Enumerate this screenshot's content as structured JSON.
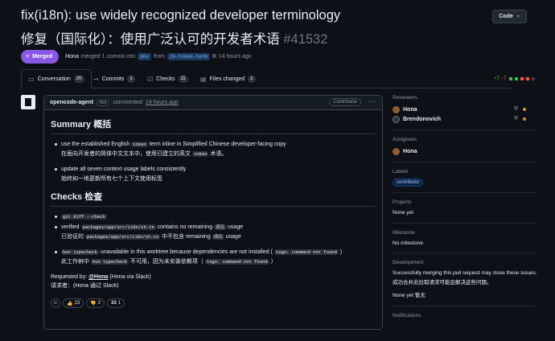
{
  "header": {
    "title": "fix(i18n): use widely recognized developer terminology",
    "subtitle": "修复（国际化）：使用广泛认可的开发者术语",
    "number": "#41532",
    "code_button": "Code"
  },
  "meta": {
    "status": "Merged",
    "author": "Hona",
    "action": "merged 1 commit into",
    "base_branch": "dev",
    "from_word": "from",
    "head_branch": "zh-token-term",
    "time": "14 hours ago"
  },
  "tabs": [
    {
      "label": "Conversation",
      "count": "20"
    },
    {
      "label": "Commits",
      "count": "1"
    },
    {
      "label": "Checks",
      "count": "11"
    },
    {
      "label": "Files changed",
      "count": "1"
    }
  ],
  "diffstat": {
    "add": "+7",
    "del": "−7"
  },
  "comment": {
    "author": "opencode-agent",
    "bot": "Bot",
    "action": "commented",
    "time": "14 hours ago",
    "role": "Contributor",
    "summary_heading": "Summary  概括",
    "summary_items": [
      {
        "pre": "use the established English",
        "code": "token",
        "post": "term inline in Simplified Chinese developer-facing copy",
        "sub_pre": "在面向开发者的简体中文文本中，使用已建立的英文",
        "sub_code": "token",
        "sub_post": "术语。"
      },
      {
        "text": "update all seven context usage labels consistently",
        "sub": "始终如一地更新所有七个上下文使用标签"
      }
    ],
    "checks_heading": "Checks  检查",
    "checks_items": {
      "c1_code": "git diff --check",
      "c2_pre": "verified",
      "c2_code": "packages/app/src/i18n/zh.ts",
      "c2_mid": "contains no remaining",
      "c2_code2": "词元",
      "c2_post": "usage",
      "c2_sub_pre": "已验证的",
      "c2_sub_code": "packages/app/src/i18n/zh.ts",
      "c2_sub_mid": "中不包含 remaining",
      "c2_sub_code2": "词元",
      "c2_sub_post": "usage",
      "c3_code": "bun typecheck",
      "c3_mid": "unavailable in this worktree because dependencies are not installed (",
      "c3_code2": "tsgo: command not found",
      "c3_post": ")",
      "c3_sub_pre": "此工作树中",
      "c3_sub_code": "bun typecheck",
      "c3_sub_mid": "不可用，因为未安装依赖项（",
      "c3_sub_code2": "tsgo: command not found",
      "c3_sub_post": "）"
    },
    "requested_pre": "Requested by:",
    "requested_user": "@Hona",
    "requested_post": "(Hona via Slack)",
    "requested_zh": "请求者：(Hona 通过 Slack)",
    "reactions": [
      {
        "emoji": "👍",
        "count": "13"
      },
      {
        "emoji": "👎",
        "count": "2"
      },
      {
        "emoji": "33",
        "count": "1"
      }
    ]
  },
  "sidebar": {
    "reviewers_title": "Reviewers",
    "reviewers": [
      "Hona",
      "Brendonovich"
    ],
    "assignees_title": "Assignees",
    "assignee": "Hona",
    "labels_title": "Labels",
    "label": "contributor",
    "projects_title": "Projects",
    "projects_value": "None yet",
    "milestone_title": "Milestone",
    "milestone_value": "No milestone",
    "development_title": "Development",
    "development_text": "Successfully merging this pull request may close these issues.",
    "development_zh": "成功合并此拉取请求可能会解决这些问题。",
    "development_none": "None yet  暂无",
    "notifications_title": "Notifications"
  },
  "colors": {
    "merged": "#8957e5",
    "link": "#4493f8",
    "add": "#3fb950",
    "del": "#f85149",
    "pending": "#d29922"
  }
}
